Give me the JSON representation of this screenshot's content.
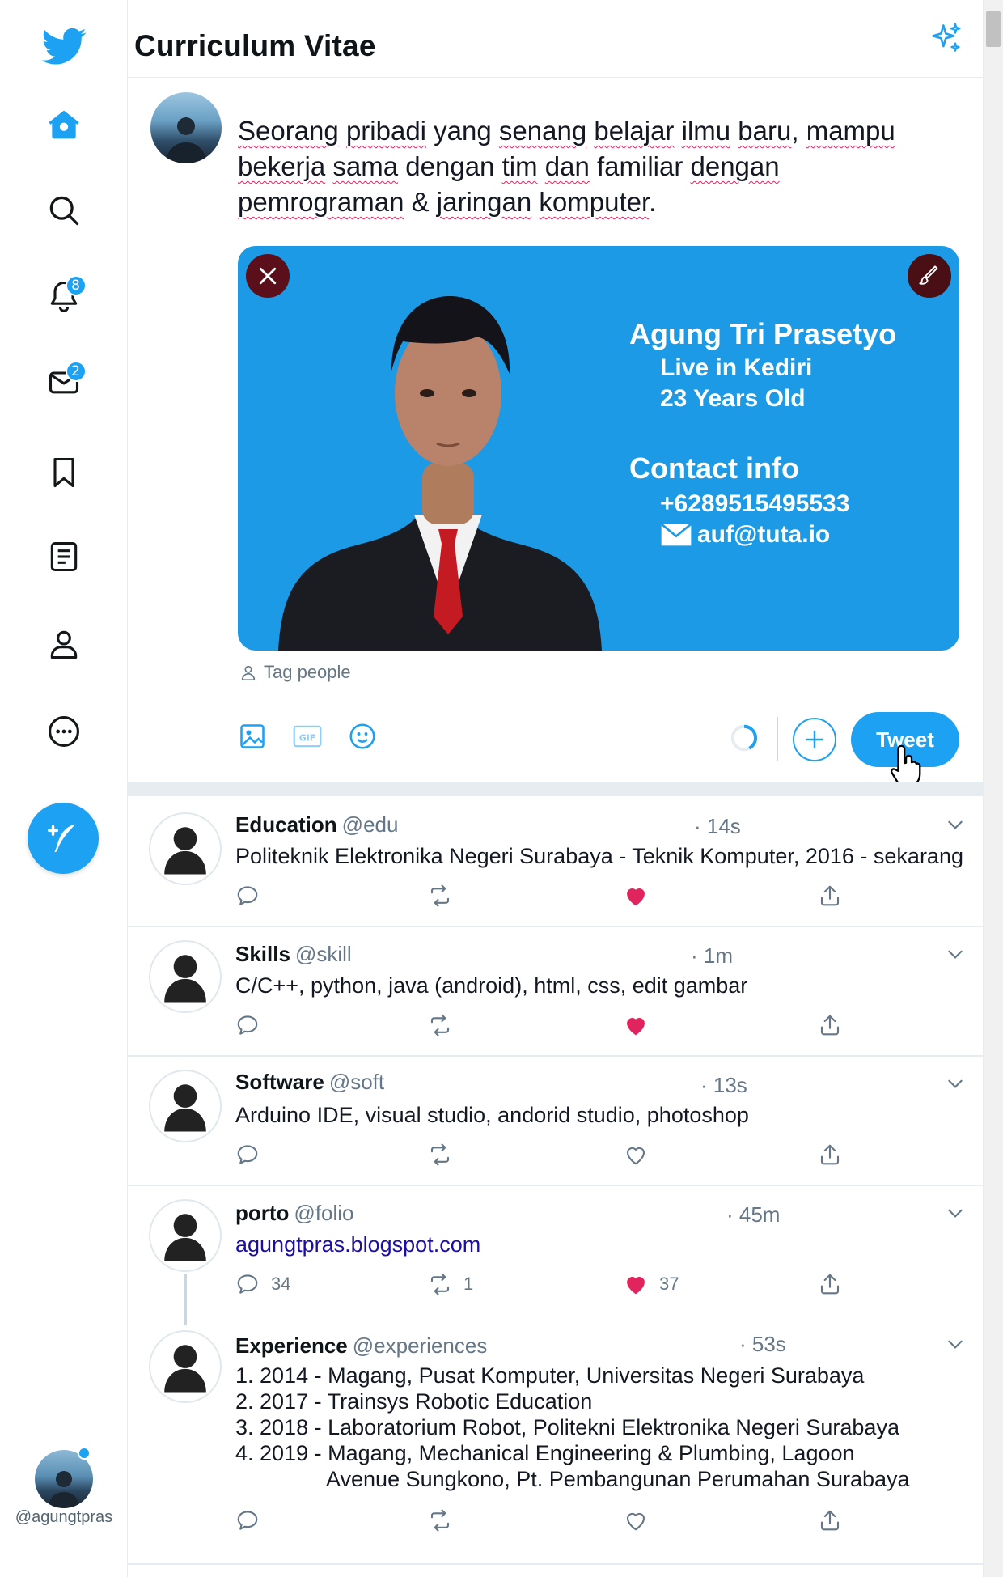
{
  "app": {
    "title": "Curriculum Vitae",
    "accent": "#1da1f2",
    "like_color": "#e0245e"
  },
  "sidebar": {
    "items": [
      {
        "name": "bird-logo",
        "icon": "bird-icon"
      },
      {
        "name": "home",
        "icon": "home-icon"
      },
      {
        "name": "explore",
        "icon": "search-icon"
      },
      {
        "name": "notifications",
        "icon": "bell-icon",
        "badge": "8"
      },
      {
        "name": "messages",
        "icon": "envelope-icon",
        "badge": "2"
      },
      {
        "name": "bookmarks",
        "icon": "bookmark-icon"
      },
      {
        "name": "lists",
        "icon": "list-icon"
      },
      {
        "name": "profile",
        "icon": "person-icon"
      },
      {
        "name": "more",
        "icon": "more-icon"
      }
    ],
    "compose_icon": "feather-plus-icon",
    "user_handle": "@agungtpras"
  },
  "composer": {
    "text_words": [
      "Seorang",
      " ",
      "pribadi",
      " yang ",
      "senang",
      " ",
      "belajar",
      " ",
      "ilmu",
      " ",
      "baru",
      ", ",
      "mampu",
      " ",
      "bekerja",
      " ",
      "sama",
      " dengan ",
      "tim",
      " ",
      "dan",
      " familiar ",
      "dengan",
      " ",
      "pemrograman",
      " & ",
      "jaringan",
      " ",
      "komputer",
      "."
    ],
    "card": {
      "name": "Agung Tri Prasetyo",
      "line1": "Live in Kediri",
      "line2": "23 Years Old",
      "contact_title": "Contact info",
      "phone": "+6289515495533",
      "email": "auf@tuta.io"
    },
    "tag_people": "Tag people",
    "tweet_button": "Tweet"
  },
  "tweets": [
    {
      "name": "Education",
      "handle": "@edu",
      "time": "· 14s",
      "body": "Politeknik Elektronika Negeri Surabaya - Teknik Komputer, 2016 - sekarang",
      "liked": true
    },
    {
      "name": "Skills",
      "handle": "@skill",
      "time": "· 1m",
      "body": "C/C++, python, java (android), html, css, edit gambar",
      "liked": true
    },
    {
      "name": "Software",
      "handle": "@soft",
      "time": "· 13s",
      "body": "Arduino IDE, visual studio, andorid studio, photoshop",
      "liked": false
    },
    {
      "name": "porto",
      "handle": "@folio",
      "time": "· 45m",
      "body": "agungtpras.blogspot.com",
      "liked": true,
      "replies": "34",
      "retweets": "1",
      "likes": "37"
    },
    {
      "name": "Experience",
      "handle": "@experiences",
      "time": "· 53s",
      "liked": false,
      "items": [
        "1. 2014 - Magang, Pusat Komputer, Universitas Negeri Surabaya",
        "2. 2017 - Trainsys Robotic Education",
        "3. 2018 - Laboratorium Robot, Politekni Elektronika Negeri Surabaya",
        "4. 2019 - Magang, Mechanical Engineering & Plumbing, Lagoon",
        "Avenue Sungkono, Pt. Pembangunan Perumahan Surabaya"
      ]
    }
  ]
}
